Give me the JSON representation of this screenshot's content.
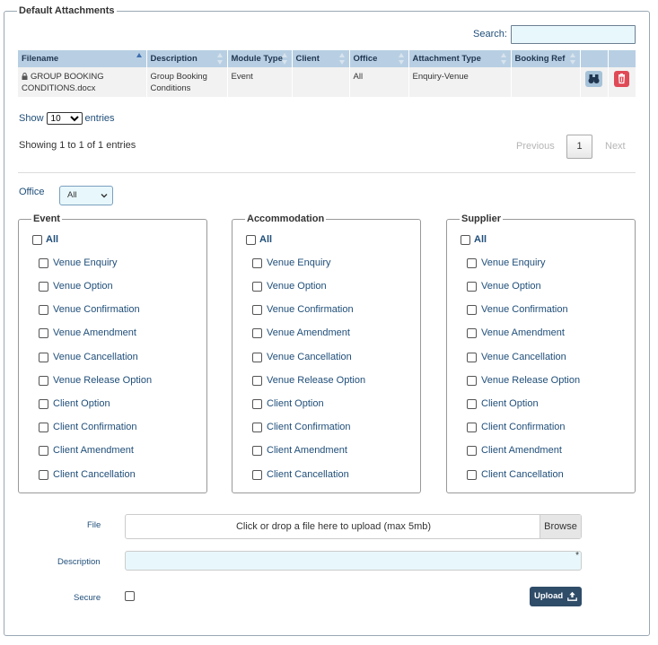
{
  "panel": {
    "title": "Default Attachments"
  },
  "search": {
    "label": "Search:",
    "value": ""
  },
  "table": {
    "columns": [
      "Filename",
      "Description",
      "Module Type",
      "Client",
      "Office",
      "Attachment Type",
      "Booking Ref"
    ],
    "rows": [
      {
        "filename_line1": "GROUP BOOKING",
        "filename_line2": "CONDITIONS.docx",
        "description_line1": "Group Booking",
        "description_line2": "Conditions",
        "module_type": "Event",
        "client": "",
        "office": "All",
        "attachment_type": "Enquiry-Venue",
        "booking_ref": ""
      }
    ]
  },
  "length": {
    "show": "Show",
    "value": "10",
    "entries": "entries"
  },
  "info": "Showing 1 to 1 of 1 entries",
  "pager": {
    "previous": "Previous",
    "page": "1",
    "next": "Next"
  },
  "office": {
    "label": "Office",
    "value": "All"
  },
  "groups": [
    {
      "title": "Event",
      "all": "All"
    },
    {
      "title": "Accommodation",
      "all": "All"
    },
    {
      "title": "Supplier",
      "all": "All"
    }
  ],
  "options": [
    "Venue Enquiry",
    "Venue Option",
    "Venue Confirmation",
    "Venue Amendment",
    "Venue Cancellation",
    "Venue Release Option",
    "Client Option",
    "Client Confirmation",
    "Client Amendment",
    "Client Cancellation"
  ],
  "form": {
    "file_label": "File",
    "file_placeholder": "Click or drop a file here to upload (max 5mb)",
    "browse": "Browse",
    "description_label": "Description",
    "required_mark": "*",
    "secure_label": "Secure",
    "upload": "Upload"
  },
  "colors": {
    "header_bg": "#b8cfe3",
    "link_text": "#1f4e79",
    "input_bg": "#e8f7fb",
    "delete_button": "#e04a57",
    "view_button": "#a6c2d9",
    "upload_button": "#2f4c68"
  },
  "icons": [
    "lock-icon",
    "binoculars-icon",
    "trash-icon",
    "upload-icon",
    "sort-icon"
  ]
}
